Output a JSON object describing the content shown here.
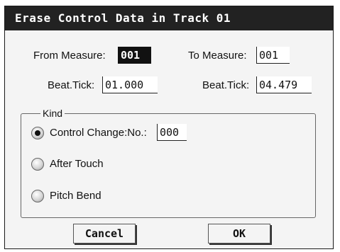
{
  "dialog": {
    "title": "Erase Control Data in Track 01",
    "from_measure": {
      "label": "From Measure:",
      "value": "001"
    },
    "to_measure": {
      "label": "To Measure:",
      "value": "001"
    },
    "from_beat_tick": {
      "label": "Beat.Tick:",
      "value": "01.000"
    },
    "to_beat_tick": {
      "label": "Beat.Tick:",
      "value": "04.479"
    },
    "kind": {
      "legend": "Kind",
      "options": [
        {
          "label": "Control Change:No.:",
          "selected": true
        },
        {
          "label": "After Touch",
          "selected": false
        },
        {
          "label": "Pitch Bend",
          "selected": false
        }
      ],
      "cc_number": "000"
    },
    "buttons": {
      "cancel": "Cancel",
      "ok": "OK"
    }
  }
}
